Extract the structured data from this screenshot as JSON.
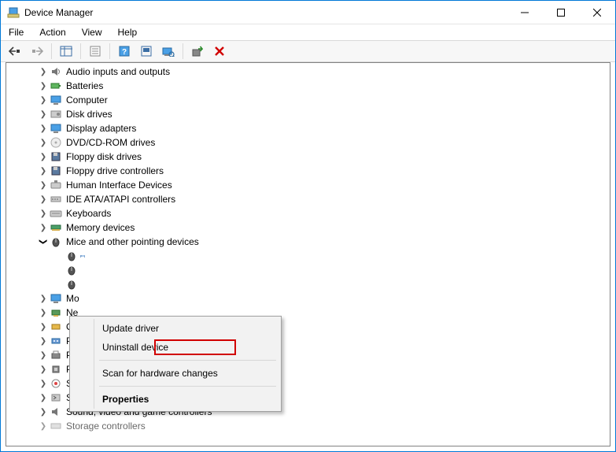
{
  "window": {
    "title": "Device Manager"
  },
  "menubar": {
    "file": "File",
    "action": "Action",
    "view": "View",
    "help": "Help"
  },
  "tree": {
    "audio": "Audio inputs and outputs",
    "batteries": "Batteries",
    "computer": "Computer",
    "disk": "Disk drives",
    "display": "Display adapters",
    "dvd": "DVD/CD-ROM drives",
    "floppydisk": "Floppy disk drives",
    "floppyctrl": "Floppy drive controllers",
    "hid": "Human Interface Devices",
    "ide": "IDE ATA/ATAPI controllers",
    "keyboards": "Keyboards",
    "memory": "Memory devices",
    "mice": "Mice and other pointing devices",
    "mouse_child1": "",
    "mouse_child2": "",
    "mouse_child3": "",
    "monitors": "Mo",
    "network": "Ne",
    "other": "Ot",
    "ports": "Ports (COM & LPT)",
    "printq": "Print queues",
    "processors": "Processors",
    "sensors": "Sensors",
    "software": "Software devices",
    "sound": "Sound, video and game controllers",
    "storage": "Storage controllers"
  },
  "context_menu": {
    "update": "Update driver",
    "uninstall": "Uninstall device",
    "scan": "Scan for hardware changes",
    "properties": "Properties"
  }
}
